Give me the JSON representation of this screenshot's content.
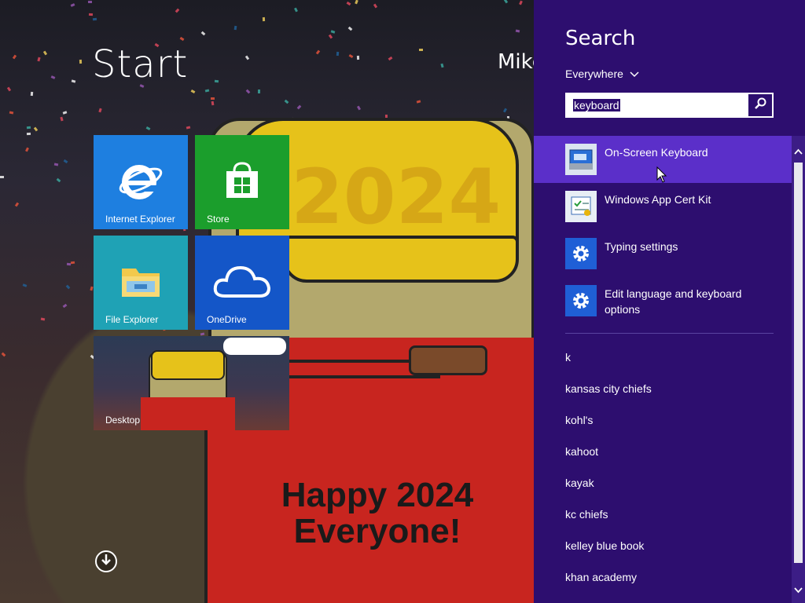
{
  "start": {
    "title": "Start",
    "user_name": "Mike",
    "wallpaper": {
      "hat_text": "2024",
      "headline_line1": "Happy 2024",
      "headline_line2": "Everyone!"
    },
    "tiles": {
      "ie": {
        "label": "Internet Explorer",
        "color": "#1e7fe0"
      },
      "store": {
        "label": "Store",
        "color": "#1b9e2c"
      },
      "explorer": {
        "label": "File Explorer",
        "color": "#1fa2b5"
      },
      "onedrive": {
        "label": "OneDrive",
        "color": "#1456c8"
      },
      "desktop": {
        "label": "Desktop"
      }
    }
  },
  "search": {
    "title": "Search",
    "scope": "Everywhere",
    "query": "keyboard",
    "accent": "#2d0e6f",
    "results": [
      {
        "label": "On-Screen Keyboard",
        "icon": "on-screen-keyboard-icon",
        "selected": true
      },
      {
        "label": "Windows App Cert Kit",
        "icon": "app-cert-kit-icon"
      },
      {
        "label": "Typing settings",
        "icon": "gear-icon"
      },
      {
        "label": "Edit language and keyboard options",
        "icon": "gear-icon"
      }
    ],
    "suggestions": [
      "k",
      "kansas city chiefs",
      "kohl's",
      "kahoot",
      "kayak",
      "kc chiefs",
      "kelley blue book",
      "khan academy"
    ]
  }
}
